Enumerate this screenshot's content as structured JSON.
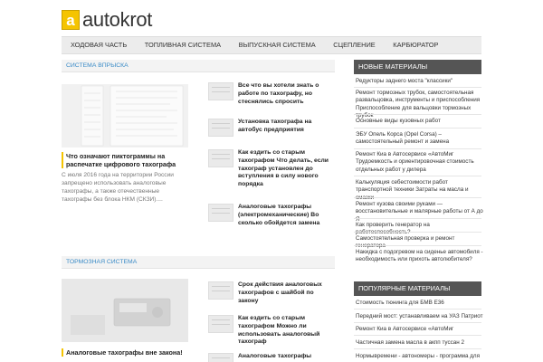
{
  "site": {
    "logo_letter": "a",
    "name": "autokrot"
  },
  "nav": [
    {
      "label": "ХОДОВАЯ ЧАСТЬ"
    },
    {
      "label": "ТОПЛИВНАЯ СИСТЕМА"
    },
    {
      "label": "ВЫПУСКНАЯ СИСТЕМА"
    },
    {
      "label": "СЦЕПЛЕНИЕ"
    },
    {
      "label": "КАРБЮРАТОР"
    }
  ],
  "section1": {
    "title": "СИСТЕМА ВПРЫСКА",
    "main": {
      "title": "Что означают пиктограммы на распечатке цифрового тахографа",
      "excerpt": "С июля 2016 года на территории России запрещено использовать аналоговые тахографы, а также отечественные тахографы без блока НКМ (СКЗИ)...."
    },
    "items": [
      {
        "title": "Все что вы хотели знать о работе по тахографу, но стеснялись спросить"
      },
      {
        "title": "Установка тахографа на автобус предприятия"
      },
      {
        "title": "Как ездить со старым тахографом Что делать, если тахограф установлен до вступления в силу нового порядка"
      },
      {
        "title": "Аналоговые тахографы (электромеханические) Во сколько обойдется замена"
      }
    ]
  },
  "section2": {
    "title": "ТОРМОЗНАЯ СИСТЕМА",
    "main": {
      "title": "Аналоговые тахографы вне закона!"
    },
    "items": [
      {
        "title": "Срок действия аналоговых тахографов с шайбой по закону"
      },
      {
        "title": "Как ездить со старым тахографом Можно ли использовать аналоговый тахограф"
      },
      {
        "title": "Аналоговые тахографы"
      }
    ]
  },
  "sidebar": {
    "new_title": "НОВЫЕ МАТЕРИАЛЫ",
    "new_items": [
      {
        "label": "Редукторы заднего моста \"классики\""
      },
      {
        "label": "Ремонт тормозных трубок, самостоятельная развальцовка, инструменты и приспособления Приспособление для вальцовки тормозных трубок"
      },
      {
        "label": "Основные виды кузовных работ"
      },
      {
        "label": "ЭБУ Опель Корса (Opel Corsa) – самостоятельный ремонт и замена"
      },
      {
        "label": "Ремонт Киа в Автосервисе «АвтоМиг Трудоемкость и ориентировочная стоимость отдельных работ у дилера"
      },
      {
        "label": "Калькуляция себестоимости работ транспортной техники Затраты на масла и смазки"
      },
      {
        "label": "Ремонт кузова своими руками — восстановительные и малярные работы от А до Я"
      },
      {
        "label": "Как проверить генератор на работоспособность?"
      },
      {
        "label": "Самостоятельная проверка и ремонт генератора"
      },
      {
        "label": "Накидка с подогревом на сиденье автомобиля - необходимость или прихоть автолюбителя?"
      }
    ],
    "popular_title": "ПОПУЛЯРНЫЕ МАТЕРИАЛЫ",
    "popular_items": [
      {
        "label": "Стоимость тюнинга для БМВ Е36"
      },
      {
        "label": "Передний мост: устанавливаем на УАЗ Патриот"
      },
      {
        "label": "Ремонт Киа в Автосервисе «АвтоМиг"
      },
      {
        "label": "Частичная замена масла в акпп туссан 2"
      },
      {
        "label": "Нормывремени - автономеры - программа для"
      }
    ]
  }
}
